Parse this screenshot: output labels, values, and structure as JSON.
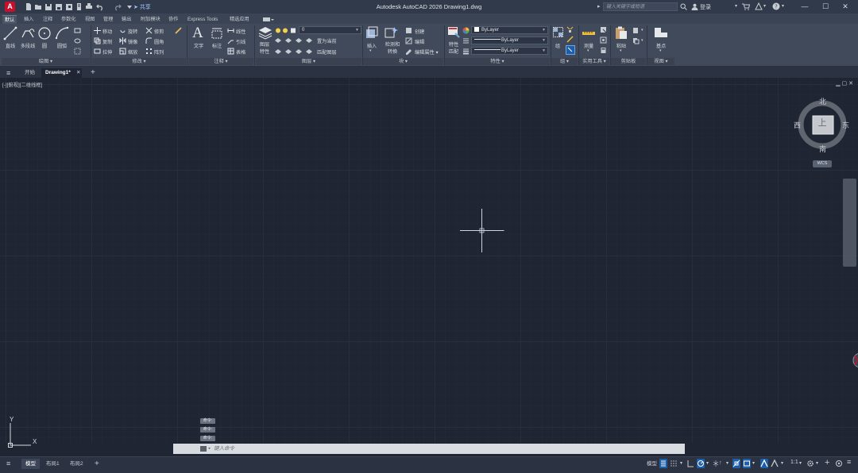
{
  "window": {
    "title": "Autodesk AutoCAD 2026   Drawing1.dwg",
    "app_logo": "A",
    "share_label": "共享",
    "search_placeholder": "键入关键字或短语",
    "login_label": "登录",
    "minimize": "—",
    "maximize": "☐",
    "close": "✕"
  },
  "ribbon_tabs": [
    {
      "label": "默认",
      "active": true
    },
    {
      "label": "插入"
    },
    {
      "label": "注释"
    },
    {
      "label": "参数化"
    },
    {
      "label": "视图"
    },
    {
      "label": "管理"
    },
    {
      "label": "输出"
    },
    {
      "label": "附加模块"
    },
    {
      "label": "协作"
    },
    {
      "label": "Express Tools"
    },
    {
      "label": "精选应用"
    }
  ],
  "ribbon": {
    "draw": {
      "title": "绘图 ▾",
      "line": "直线",
      "polyline": "多段线",
      "circle": "圆",
      "arc": "圆弧"
    },
    "modify": {
      "title": "修改 ▾",
      "move": "移动",
      "rotate": "旋转",
      "trim": "修剪",
      "copy": "复制",
      "mirror": "镜像",
      "fillet": "圆角",
      "stretch": "拉伸",
      "scale": "缩放",
      "array": "阵列"
    },
    "annotation": {
      "title": "注释 ▾",
      "text": "文字",
      "dimension": "标注",
      "linear": "线性",
      "leader": "引线",
      "table": "表格"
    },
    "layers": {
      "title": "图层 ▾",
      "properties_l1": "图层",
      "properties_l2": "特性",
      "layer_value": "0",
      "make_current": "置为当前",
      "match_layer": "匹配图层"
    },
    "block": {
      "title": "块 ▾",
      "insert": "插入",
      "edit_l1": "检测和",
      "edit_l2": "转换",
      "create": "创建",
      "editor": "编辑",
      "edit_attr": "编辑属性 ▾"
    },
    "properties": {
      "title": "特性 ▾",
      "match_l1": "特性",
      "match_l2": "匹配",
      "color": "ByLayer",
      "linetype": "ByLayer",
      "lineweight": "ByLayer"
    },
    "groups": {
      "title": "组 ▾",
      "group": "组"
    },
    "utilities": {
      "title": "实用工具 ▾",
      "measure": "测量"
    },
    "clipboard": {
      "title": "剪贴板",
      "paste": "粘贴"
    },
    "view": {
      "title": "视图 ▾",
      "base": "基点"
    }
  },
  "file_tabs": {
    "menu_icon": "≡",
    "start": "开始",
    "drawing": "Drawing1*",
    "close": "✕",
    "add": "+"
  },
  "viewport": {
    "label": "[-][俯视][二维线框]",
    "controls": "▁ ▢ ✕",
    "viewcube": {
      "north": "北",
      "south": "南",
      "east": "东",
      "west": "西",
      "top": "上"
    },
    "wcs": "WCS",
    "ucs_x": "X",
    "ucs_y": "Y"
  },
  "command": {
    "history": [
      "命令:",
      "命令:",
      "命令:"
    ],
    "placeholder": "键入命令"
  },
  "status": {
    "layouts": [
      {
        "label": "模型",
        "active": true
      },
      {
        "label": "布局1"
      },
      {
        "label": "布局2"
      }
    ],
    "model_label": "模型",
    "scale": "1:1"
  },
  "colors": {
    "background": "#1f2533",
    "ribbon": "#414a5a",
    "accent_blue": "#1c5fa8",
    "logo_red": "#c8102e"
  }
}
